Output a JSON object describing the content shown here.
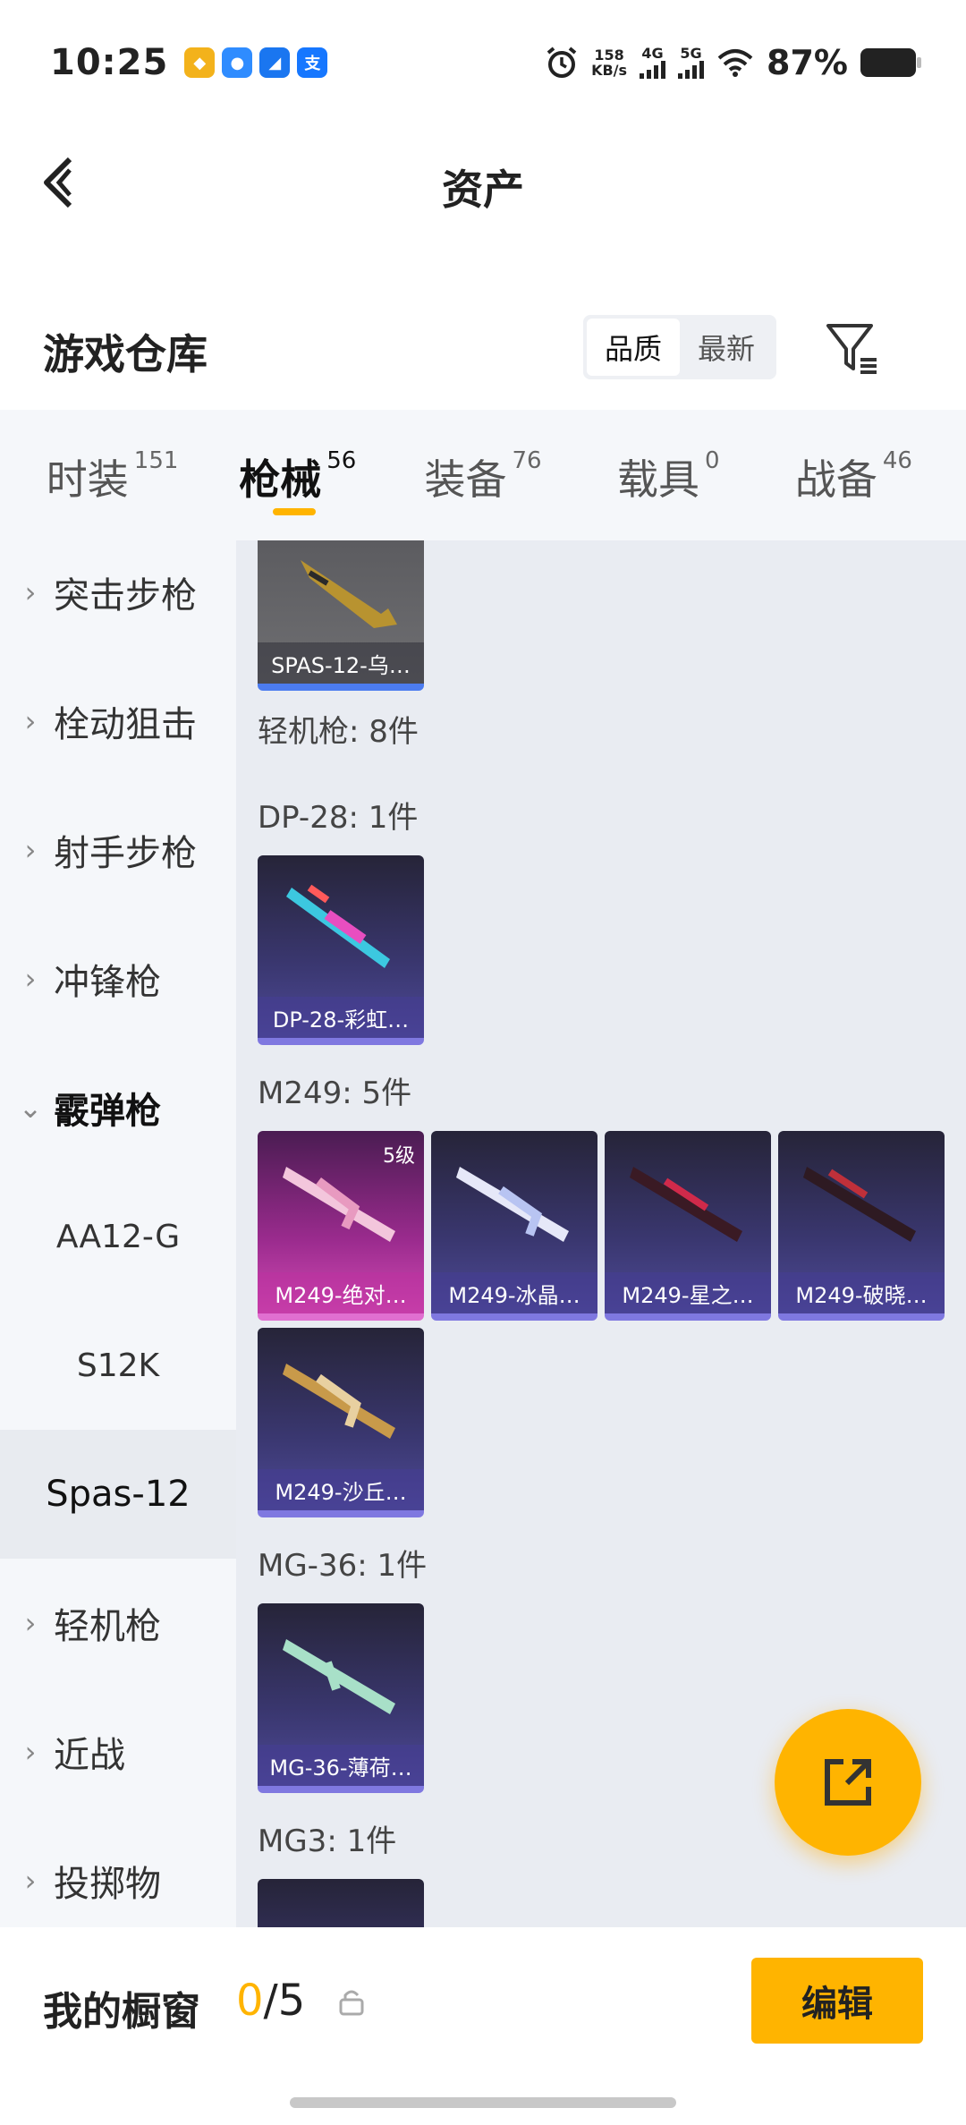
{
  "status": {
    "time": "10:25",
    "speed_value": "158",
    "speed_unit": "KB/s",
    "sig1": "4G",
    "sig2": "5G",
    "battery": "87%"
  },
  "header": {
    "title": "资产"
  },
  "section": {
    "title": "游戏仓库",
    "sort_quality": "品质",
    "sort_latest": "最新"
  },
  "tabs": [
    {
      "label": "时装",
      "count": "151"
    },
    {
      "label": "枪械",
      "count": "56"
    },
    {
      "label": "装备",
      "count": "76"
    },
    {
      "label": "载具",
      "count": "0"
    },
    {
      "label": "战备",
      "count": "46"
    }
  ],
  "sidebar": {
    "items": [
      {
        "label": "突击步枪"
      },
      {
        "label": "栓动狙击"
      },
      {
        "label": "射手步枪"
      },
      {
        "label": "冲锋枪"
      },
      {
        "label": "霰弹枪"
      },
      {
        "label": "轻机枪"
      },
      {
        "label": "近战"
      },
      {
        "label": "投掷物"
      }
    ],
    "sub_items": [
      {
        "label": "AA12-G"
      },
      {
        "label": "S12K"
      },
      {
        "label": "Spas-12"
      }
    ]
  },
  "content": {
    "top_card": {
      "name": "SPAS-12-乌…"
    },
    "lmg_header": "轻机枪: 8件",
    "groups": [
      {
        "title": "DP-28: 1件",
        "cards": [
          {
            "name": "DP-28-彩虹…"
          }
        ]
      },
      {
        "title": "M249: 5件",
        "cards": [
          {
            "name": "M249-绝对…",
            "level": "5级"
          },
          {
            "name": "M249-冰晶…"
          },
          {
            "name": "M249-星之…"
          },
          {
            "name": "M249-破晓…"
          },
          {
            "name": "M249-沙丘…"
          }
        ]
      },
      {
        "title": "MG-36: 1件",
        "cards": [
          {
            "name": "MG-36-薄荷…"
          }
        ]
      },
      {
        "title": "MG3: 1件",
        "cards": []
      }
    ]
  },
  "bottom": {
    "title": "我的橱窗",
    "count_current": "0",
    "count_total": "/5",
    "edit": "编辑"
  },
  "colors": {
    "accent": "#ffb400",
    "card_purple": "#3a3770",
    "card_pink": "#9b2b8e"
  }
}
